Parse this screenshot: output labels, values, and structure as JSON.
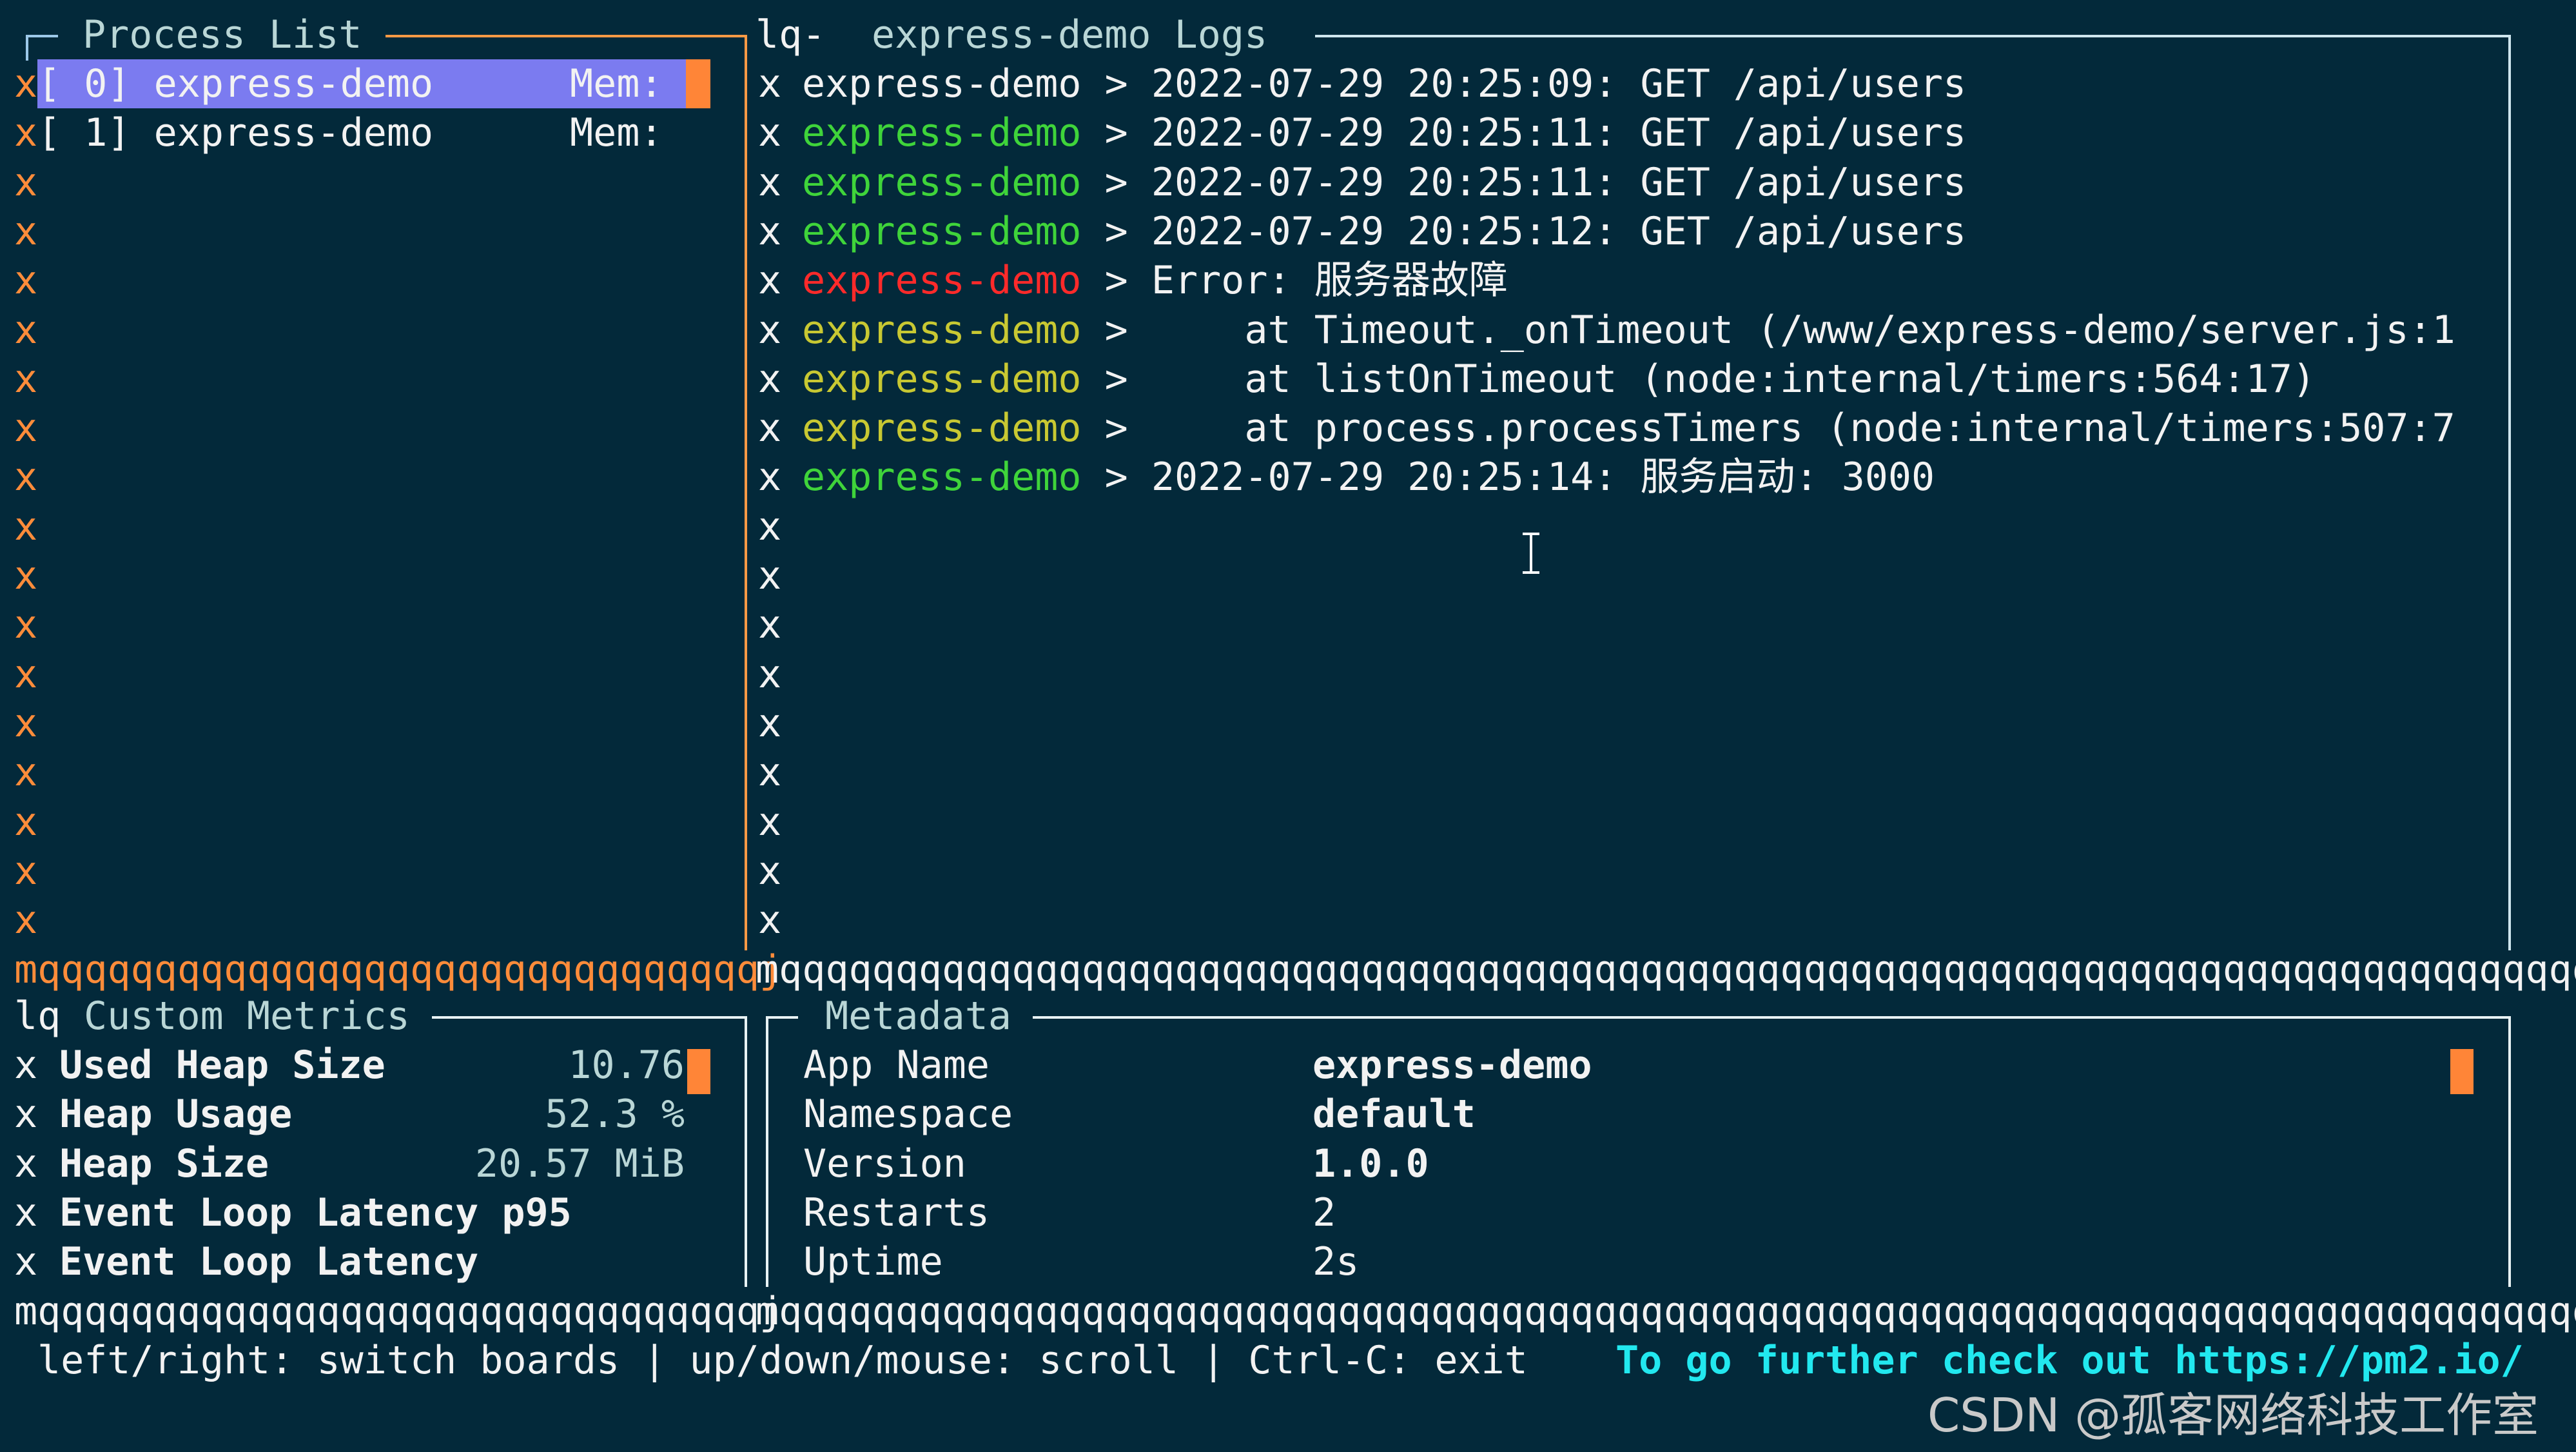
{
  "process_list": {
    "title": "Process List",
    "border_marker": "x",
    "processes": [
      {
        "index": "[ 0]",
        "name": "express-demo",
        "mem_label": "Mem:",
        "selected": true
      },
      {
        "index": "[ 1]",
        "name": "express-demo",
        "mem_label": "Mem:",
        "selected": false
      }
    ]
  },
  "logs": {
    "title_prefix": "lq-",
    "title": "express-demo Logs",
    "border_marker": "x",
    "entries": [
      {
        "source": "express-demo",
        "source_color": "white",
        "sep": ">",
        "message": "2022-07-29 20:25:09: GET /api/users"
      },
      {
        "source": "express-demo",
        "source_color": "green",
        "sep": ">",
        "message": "2022-07-29 20:25:11: GET /api/users"
      },
      {
        "source": "express-demo",
        "source_color": "green",
        "sep": ">",
        "message": "2022-07-29 20:25:11: GET /api/users"
      },
      {
        "source": "express-demo",
        "source_color": "green",
        "sep": ">",
        "message": "2022-07-29 20:25:12: GET /api/users"
      },
      {
        "source": "express-demo",
        "source_color": "red",
        "sep": ">",
        "message": "Error: 服务器故障"
      },
      {
        "source": "express-demo",
        "source_color": "yellow",
        "sep": ">",
        "message": "    at Timeout._onTimeout (/www/express-demo/server.js:1"
      },
      {
        "source": "express-demo",
        "source_color": "yellow",
        "sep": ">",
        "message": "    at listOnTimeout (node:internal/timers:564:17)"
      },
      {
        "source": "express-demo",
        "source_color": "yellow",
        "sep": ">",
        "message": "    at process.processTimers (node:internal/timers:507:7"
      },
      {
        "source": "express-demo",
        "source_color": "green",
        "sep": ">",
        "message": "2022-07-29 20:25:14: 服务启动: 3000"
      }
    ]
  },
  "separator": {
    "left": "mqqqqqqqqqqqqqqqqqqqqqqqqqqqqqqqj",
    "right": "mqqqqqqqqqqqqqqqqqqqqqqqqqqqqqqqqqqqqqqqqqqqqqqqqqqqqqqqqqqqqqqqqqqqqqqqqqqqqqqqqqqqj"
  },
  "custom_metrics": {
    "title_prefix": "lq",
    "title": "Custom Metrics",
    "border_marker": "x",
    "items": [
      {
        "label": "Used Heap Size",
        "value": "10.76"
      },
      {
        "label": "Heap Usage",
        "value": "52.3 %"
      },
      {
        "label": "Heap Size",
        "value": "20.57 MiB"
      },
      {
        "label": "Event Loop Latency p95",
        "value": ""
      },
      {
        "label": "Event Loop Latency",
        "value": ""
      }
    ]
  },
  "metadata": {
    "title": "Metadata",
    "items": [
      {
        "key": "App Name",
        "value": "express-demo",
        "bold": true
      },
      {
        "key": "Namespace",
        "value": "default",
        "bold": true
      },
      {
        "key": "Version",
        "value": "1.0.0",
        "bold": true
      },
      {
        "key": "Restarts",
        "value": "2",
        "bold": false
      },
      {
        "key": "Uptime",
        "value": "2s",
        "bold": false
      }
    ]
  },
  "footer": {
    "help": "left/right: switch boards | up/down/mouse: scroll | Ctrl-C: exit",
    "promo": "To go further check out https://pm2.io/"
  },
  "watermark": "CSDN @孤客网络科技工作室",
  "colors": {
    "background": "#03293a",
    "accent_orange": "#ff8c3a",
    "selection": "#7b7bf0",
    "green": "#3fd43a",
    "red": "#ff2a2a",
    "yellow": "#c8c832",
    "cyan": "#22e8ef"
  }
}
